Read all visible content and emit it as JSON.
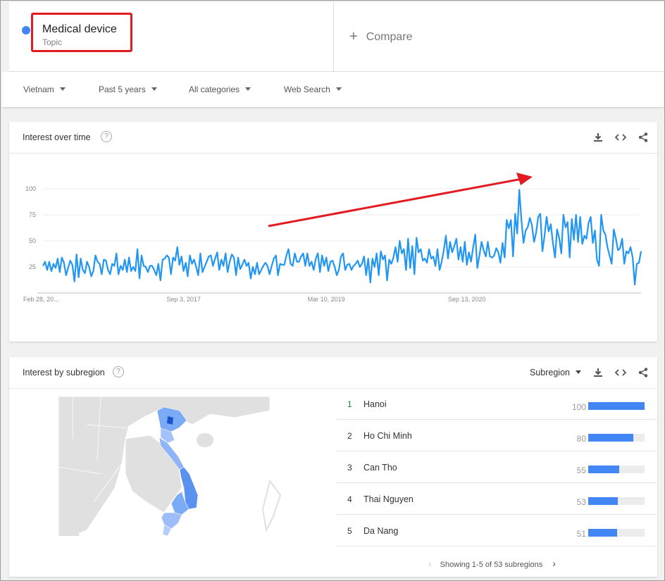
{
  "term": {
    "name": "Medical device",
    "type": "Topic",
    "dot_color": "#4285f4",
    "compare_label": "Compare"
  },
  "filters": {
    "region": "Vietnam",
    "period": "Past 5 years",
    "category": "All categories",
    "search_type": "Web Search"
  },
  "interest_over_time": {
    "title": "Interest over time",
    "icons": [
      "download-icon",
      "embed-icon",
      "share-icon"
    ]
  },
  "chart_data": {
    "type": "line",
    "title": "",
    "y_ticks": [
      "100",
      "75",
      "50",
      "25"
    ],
    "ylim": [
      0,
      100
    ],
    "x_tick_labels": [
      "Feb 28, 20...",
      "Sep 3, 2017",
      "Mar 10, 2019",
      "Sep 13, 2020"
    ],
    "x_tick_index": [
      0,
      67,
      135,
      202
    ],
    "annotation": "red arrow pointing up-right toward the peak",
    "line_color": "#2196f3",
    "series": [
      {
        "values": [
          26,
          30,
          22,
          30,
          21,
          28,
          24,
          33,
          20,
          34,
          29,
          17,
          24,
          31,
          27,
          11,
          37,
          15,
          33,
          22,
          19,
          30,
          25,
          16,
          21,
          36,
          30,
          28,
          18,
          32,
          31,
          22,
          18,
          28,
          26,
          38,
          18,
          26,
          22,
          32,
          20,
          34,
          21,
          25,
          21,
          42,
          14,
          36,
          26,
          25,
          20,
          26,
          26,
          22,
          17,
          28,
          12,
          32,
          33,
          36,
          34,
          18,
          34,
          31,
          44,
          27,
          35,
          21,
          29,
          16,
          36,
          28,
          32,
          25,
          17,
          38,
          20,
          25,
          30,
          35,
          36,
          26,
          33,
          39,
          22,
          32,
          26,
          38,
          20,
          30,
          37,
          34,
          17,
          34,
          23,
          27,
          32,
          26,
          29,
          14,
          25,
          18,
          29,
          18,
          22,
          26,
          29,
          26,
          18,
          26,
          33,
          36,
          17,
          28,
          27,
          27,
          36,
          42,
          28,
          26,
          38,
          30,
          30,
          35,
          38,
          26,
          38,
          26,
          30,
          22,
          33,
          38,
          20,
          36,
          26,
          34,
          21,
          30,
          31,
          25,
          17,
          22,
          35,
          38,
          22,
          27,
          28,
          22,
          26,
          28,
          31,
          25,
          28,
          35,
          17,
          33,
          10,
          33,
          25,
          38,
          17,
          40,
          32,
          36,
          12,
          32,
          28,
          34,
          44,
          30,
          50,
          38,
          42,
          22,
          52,
          24,
          45,
          18,
          53,
          39,
          42,
          31,
          33,
          29,
          42,
          33,
          35,
          26,
          42,
          22,
          30,
          41,
          55,
          33,
          49,
          39,
          45,
          52,
          32,
          44,
          30,
          49,
          27,
          39,
          30,
          44,
          56,
          24,
          36,
          49,
          41,
          35,
          49,
          35,
          34,
          36,
          43,
          39,
          29,
          48,
          34,
          70,
          62,
          70,
          35,
          76,
          57,
          99,
          70,
          48,
          60,
          63,
          72,
          65,
          49,
          58,
          73,
          76,
          40,
          55,
          73,
          59,
          66,
          48,
          34,
          61,
          53,
          38,
          75,
          63,
          68,
          34,
          71,
          51,
          75,
          49,
          73,
          47,
          55,
          52,
          67,
          73,
          48,
          60,
          32,
          26,
          75,
          60,
          56,
          44,
          36,
          28,
          61,
          52,
          41,
          43,
          52,
          28,
          40,
          38,
          44,
          34,
          8,
          28,
          29,
          40
        ]
      }
    ]
  },
  "interest_by_subregion": {
    "title": "Interest by subregion",
    "selector_label": "Subregion",
    "rows": [
      {
        "rank": "1",
        "name": "Hanoi",
        "value": "100",
        "fraction": 1.0
      },
      {
        "rank": "2",
        "name": "Ho Chi Minh",
        "value": "80",
        "fraction": 0.8
      },
      {
        "rank": "3",
        "name": "Can Tho",
        "value": "55",
        "fraction": 0.55
      },
      {
        "rank": "4",
        "name": "Thai Nguyen",
        "value": "53",
        "fraction": 0.53
      },
      {
        "rank": "5",
        "name": "Da Nang",
        "value": "51",
        "fraction": 0.51
      }
    ],
    "pager_text": "Showing 1-5 of 53 subregions"
  }
}
